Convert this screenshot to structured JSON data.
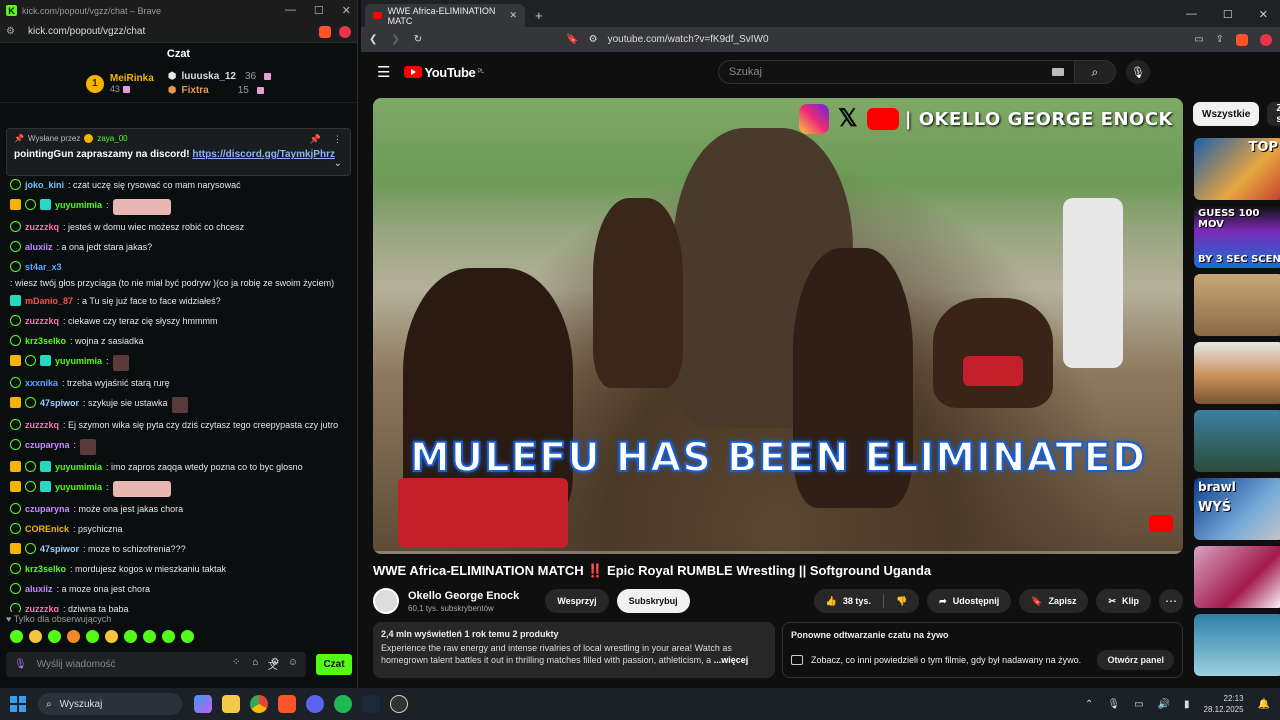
{
  "kick_window": {
    "title": "kick.com/popout/vgzz/chat – Brave",
    "url": "kick.com/popout/vgzz/chat",
    "chat_header": "Czat",
    "leaderboard": [
      {
        "rank": "1",
        "name": "MeiRinka",
        "count": "43"
      },
      {
        "name": "luuuska_12",
        "count": "36"
      },
      {
        "name": "Fixtra",
        "count": "15"
      }
    ],
    "pinned": {
      "sent_by_label": "Wysłane przez",
      "sent_by_user": "zaya_00",
      "message": "pointingGun zapraszamy na discord!",
      "link": "https://discord.gg/TaymkjPhrz"
    },
    "messages": [
      {
        "user": "joko_kini",
        "color": "#6ec6ff",
        "text": ": czat uczę się rysować co mam narysować"
      },
      {
        "user": "yuyumimia",
        "color": "#53fc18",
        "text": ":"
      },
      {
        "user": "zuzzzkq",
        "color": "#ff6fb1",
        "text": ": jesteś w domu wiec możesz robić co chcesz"
      },
      {
        "user": "aluxiiz",
        "color": "#c58bff",
        "text": ": a ona jedt stara jakas?"
      },
      {
        "user": "st4ar_x3",
        "color": "#5aa6ff",
        "text": ": wiesz twój głos przyciąga (to nie miał być podryw )(co ja robię ze swoim życiem)"
      },
      {
        "user": "mDanio_87",
        "color": "#ff4d4d",
        "text": ": a Tu się już face to face widziałeś?"
      },
      {
        "user": "zuzzzkq",
        "color": "#ff6fb1",
        "text": ": ciekawe czy teraz cię słyszy hmmmm"
      },
      {
        "user": "krz3selko",
        "color": "#53fc18",
        "text": ": wojna z sasiadka"
      },
      {
        "user": "yuyumimia",
        "color": "#53fc18",
        "text": ":"
      },
      {
        "user": "xxxnika",
        "color": "#5aa6ff",
        "text": ": trzeba wyjaśnić starą rurę"
      },
      {
        "user": "47spiwor",
        "color": "#9ad0ff",
        "text": ": szykuje sie ustawka"
      },
      {
        "user": "zuzzzkq",
        "color": "#ff6fb1",
        "text": ": Ej szymon wika się pyta czy dziś czytasz tego creepypasta czy jutro"
      },
      {
        "user": "czuparyna",
        "color": "#c58bff",
        "text": ":"
      },
      {
        "user": "yuyumimia",
        "color": "#53fc18",
        "text": ": imo zapros zaqqa wtedy pozna co to byc glosno"
      },
      {
        "user": "yuyumimia",
        "color": "#53fc18",
        "text": ":"
      },
      {
        "user": "czuparyna",
        "color": "#c58bff",
        "text": ": może ona jest jakas chora"
      },
      {
        "user": "COREnick",
        "color": "#f4b400",
        "text": ": psychiczna"
      },
      {
        "user": "47spiwor",
        "color": "#9ad0ff",
        "text": ": moze to schizofrenia???"
      },
      {
        "user": "krz3selko",
        "color": "#53fc18",
        "text": ": mordujesz kogos w mieszkaniu taktak"
      },
      {
        "user": "aluxiiz",
        "color": "#c58bff",
        "text": ": a moze ona jest chora"
      },
      {
        "user": "zuzzzkq",
        "color": "#ff6fb1",
        "text": ": dziwna tą baba"
      }
    ],
    "followers_only": "Tylko dla obserwujących",
    "input_placeholder": "Wyślij wiadomość",
    "send_label": "Czat"
  },
  "browser": {
    "tab_title": "WWE Africa-ELIMINATION MATC",
    "url": "youtube.com/watch?v=fK9df_SvIW0"
  },
  "youtube": {
    "logo": "YouTube",
    "logo_region": "PL",
    "search_placeholder": "Szukaj",
    "video_overlay_brand": "OKELLO GEORGE ENOCK",
    "video_overlay_title": "MULEFU HAS BEEN ELIMINATED",
    "title": "WWE Africa-ELIMINATION MATCH ‼️ Epic Royal RUMBLE Wrestling || Softground Uganda",
    "channel": "Okello George Enock",
    "subscribers": "60,1 tys. subskrybentów",
    "support_label": "Wesprzyj",
    "subscribe_label": "Subskrybuj",
    "likes": "38 tys.",
    "share_label": "Udostępnij",
    "save_label": "Zapisz",
    "clip_label": "Klip",
    "desc_stats": "2,4 mln wyświetleń  1 rok temu  2 produkty",
    "desc_text": "Experience the raw energy and intense rivalries of local wrestling in your area! Watch as homegrown talent battles it out in thrilling matches filled with passion, athleticism, a",
    "desc_more": "...więcej",
    "replay_title": "Ponowne odtwarzanie czatu na żywo",
    "replay_text": "Zobacz, co inni powiedzieli o tym filmie, gdy był nadawany na żywo.",
    "replay_button": "Otwórz panel",
    "chips": [
      "Wszystkie",
      "Z se"
    ],
    "thumb_texts": [
      "TOP",
      "GUESS 100 MOV",
      "BY 3 SEC SCEN",
      "brawl",
      "WYŚ"
    ]
  },
  "taskbar": {
    "search": "Wyszukaj",
    "time": "22:13",
    "date": "28.12.2025"
  }
}
